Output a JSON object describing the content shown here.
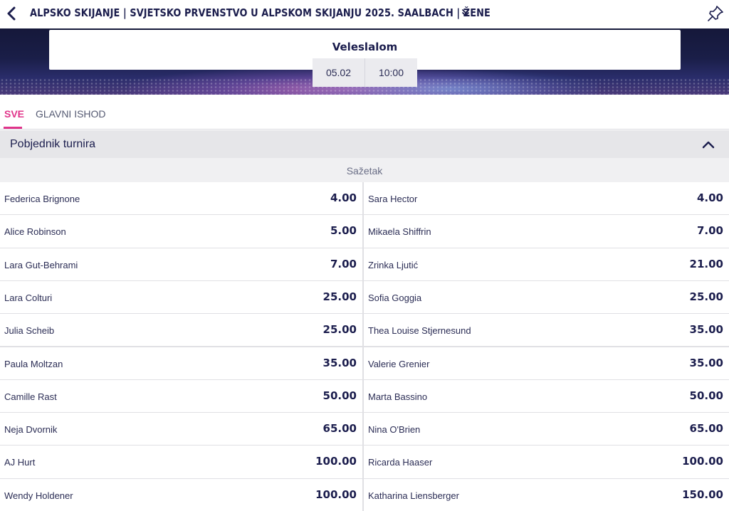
{
  "header": {
    "title": "ALPSKO SKIJANJE | SVJETSKO PRVENSTVO U ALPSKOM SKIJANJU 2025. SAALBACH | ŽENE"
  },
  "event": {
    "name": "Veleslalom",
    "date": "05.02",
    "time": "10:00"
  },
  "tabs": [
    {
      "label": "SVE",
      "active": true
    },
    {
      "label": "GLAVNI ISHOD",
      "active": false
    }
  ],
  "market": {
    "title": "Pobjednik turnira",
    "summary_label": "Sažetak"
  },
  "selections": [
    {
      "name": "Federica Brignone",
      "odd": "4.00"
    },
    {
      "name": "Sara Hector",
      "odd": "4.00"
    },
    {
      "name": "Alice Robinson",
      "odd": "5.00"
    },
    {
      "name": "Mikaela Shiffrin",
      "odd": "7.00"
    },
    {
      "name": "Lara Gut-Behrami",
      "odd": "7.00"
    },
    {
      "name": "Zrinka Ljutić",
      "odd": "21.00"
    },
    {
      "name": "Lara Colturi",
      "odd": "25.00"
    },
    {
      "name": "Sofia Goggia",
      "odd": "25.00"
    },
    {
      "name": "Julia Scheib",
      "odd": "25.00"
    },
    {
      "name": "Thea Louise Stjernesund",
      "odd": "35.00"
    },
    {
      "name": "Paula Moltzan",
      "odd": "35.00"
    },
    {
      "name": "Valerie Grenier",
      "odd": "35.00"
    },
    {
      "name": "Camille Rast",
      "odd": "50.00"
    },
    {
      "name": "Marta Bassino",
      "odd": "50.00"
    },
    {
      "name": "Neja Dvornik",
      "odd": "65.00"
    },
    {
      "name": "Nina O'Brien",
      "odd": "65.00"
    },
    {
      "name": "AJ Hurt",
      "odd": "100.00"
    },
    {
      "name": "Ricarda Haaser",
      "odd": "100.00"
    },
    {
      "name": "Wendy Holdener",
      "odd": "100.00"
    },
    {
      "name": "Katharina Liensberger",
      "odd": "150.00"
    }
  ],
  "colors": {
    "brand_navy": "#1b1d4d",
    "accent_pink": "#e0348a"
  }
}
